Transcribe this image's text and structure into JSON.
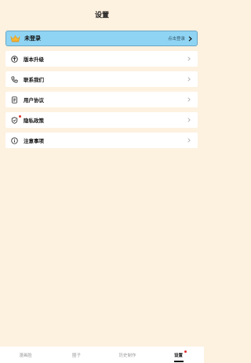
{
  "header": {
    "title": "设置"
  },
  "login": {
    "label": "未登录",
    "hint": "点击登录"
  },
  "menu": [
    {
      "label": "版本升级",
      "icon": "upgrade-icon",
      "badge": false
    },
    {
      "label": "联系我们",
      "icon": "phone-icon",
      "badge": false
    },
    {
      "label": "用户协议",
      "icon": "document-icon",
      "badge": false
    },
    {
      "label": "隐私政策",
      "icon": "shield-icon",
      "badge": true
    },
    {
      "label": "注意事项",
      "icon": "info-icon",
      "badge": false
    }
  ],
  "tabs": [
    {
      "label": "漫画脸",
      "active": false
    },
    {
      "label": "圈子",
      "active": false
    },
    {
      "label": "历史制作",
      "active": false
    },
    {
      "label": "设置",
      "active": true,
      "badge": true
    }
  ],
  "colors": {
    "background": "#fdf1e0",
    "login_card": "#8fd4f3",
    "badge": "#e0322e"
  }
}
